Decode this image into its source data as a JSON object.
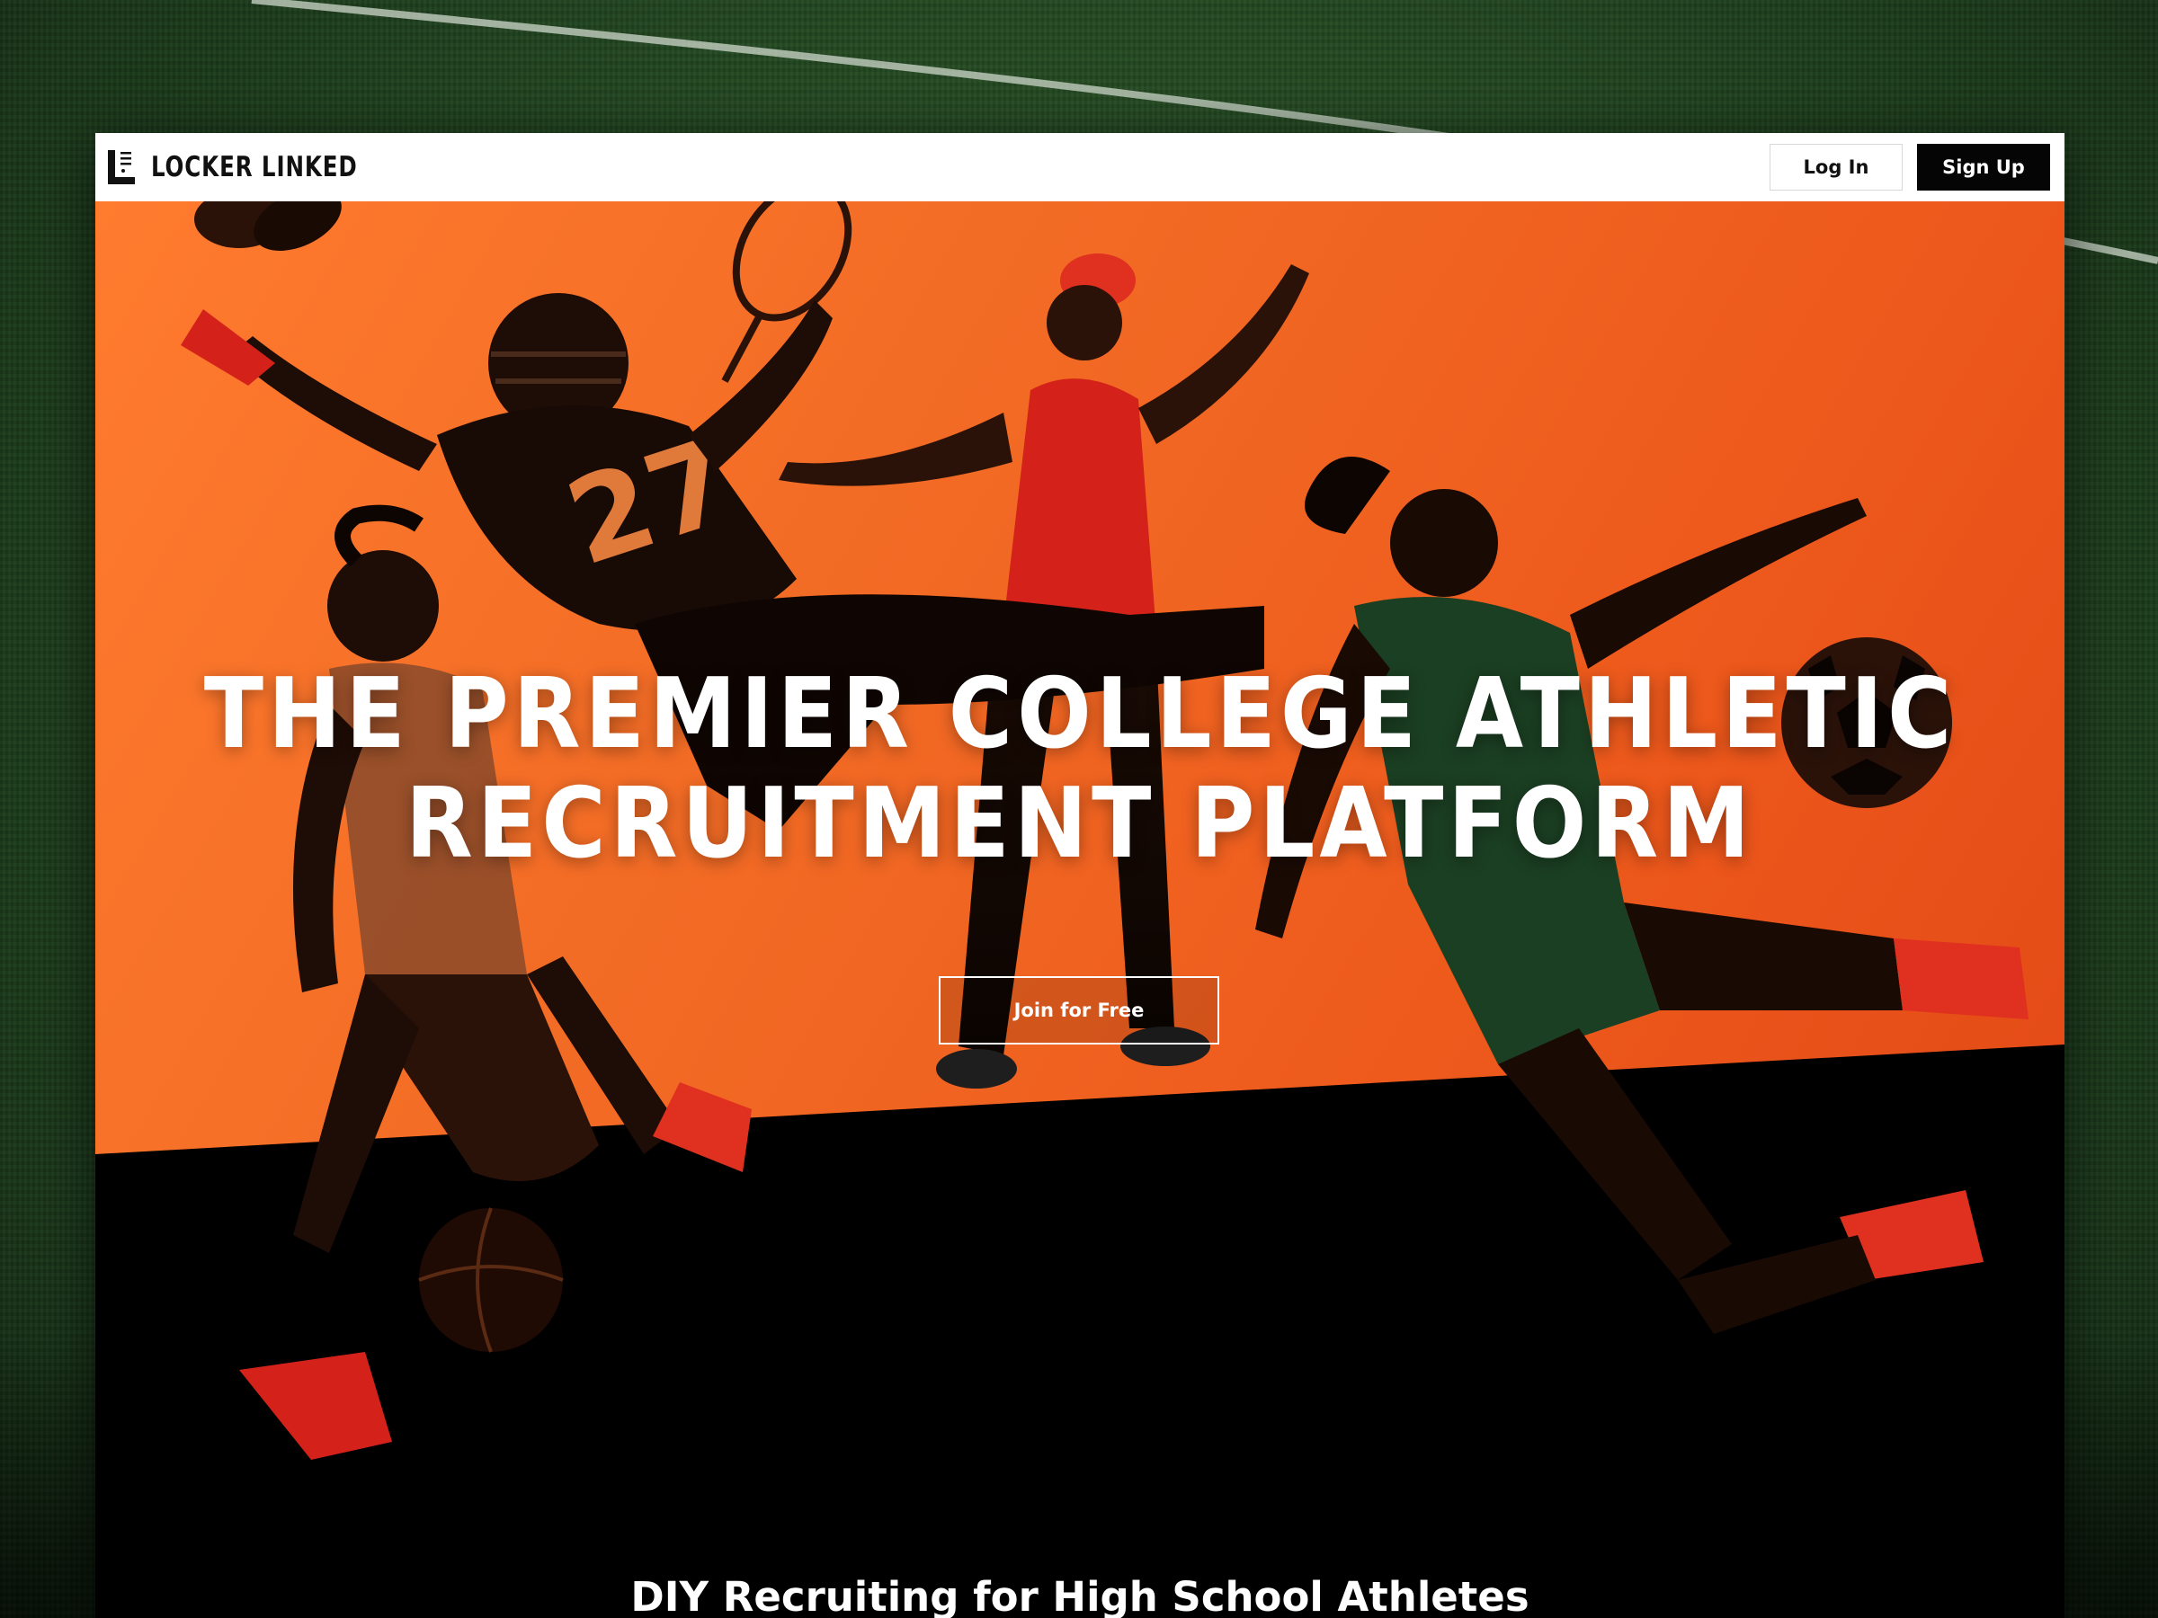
{
  "brand": {
    "name": "LOCKER LINKED",
    "icon": "locker-linked-logo"
  },
  "nav": {
    "login_label": "Log In",
    "signup_label": "Sign Up"
  },
  "hero": {
    "headline_line1": "THE PREMIER COLLEGE ATHLETIC",
    "headline_line2": "RECRUITMENT PLATFORM",
    "cta_label": "Join for Free",
    "jersey_number": "27"
  },
  "section": {
    "subhead": "DIY Recruiting for High School Athletes"
  },
  "colors": {
    "accent_orange": "#f26b25",
    "dark": "#000000",
    "nav_bg": "#ffffff",
    "field_green": "#244a22"
  }
}
